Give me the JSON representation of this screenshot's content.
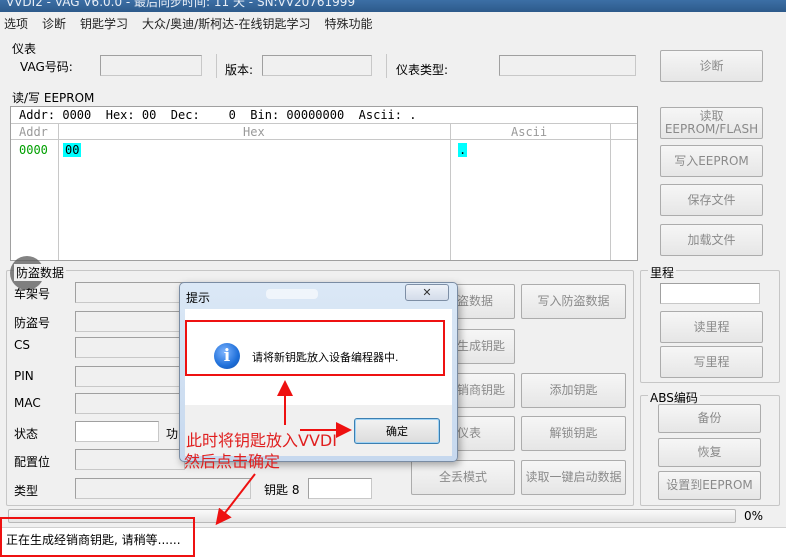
{
  "window": {
    "title": "VVDI2 - VAG V6.0.0 - 最后同步时间: 11 天 - SN:VV20761999"
  },
  "menu": [
    "选项",
    "诊断",
    "钥匙学习",
    "大众/奥迪/斯柯达-在线钥匙学习",
    "特殊功能"
  ],
  "instrument": {
    "group": "仪表",
    "vag_label": "VAG号码:",
    "version_label": "版本:",
    "type_label": "仪表类型:",
    "diagnose_button": "诊断"
  },
  "eeprom": {
    "group": "读/写 EEPROM",
    "info": {
      "addr_label": "Addr:",
      "addr": "0000",
      "hex_label": "Hex:",
      "hex": "00",
      "dec_label": "Dec:",
      "dec": "0",
      "bin_label": "Bin:",
      "bin": "00000000",
      "ascii_label": "Ascii:",
      "ascii": "."
    },
    "columns": {
      "addr": "Addr",
      "hex": "Hex",
      "ascii": "Ascii"
    },
    "row": {
      "addr": "0000",
      "hex": "00",
      "ascii": "."
    },
    "buttons": {
      "read": "读取\nEEPROM/FLASH",
      "write": "写入EEPROM",
      "save": "保存文件",
      "load": "加载文件"
    }
  },
  "immo": {
    "group": "防盗数据",
    "labels": {
      "vin": "车架号",
      "immo": "防盗号",
      "cs": "CS",
      "pin": "PIN",
      "mac": "MAC",
      "status": "状态",
      "config": "配置位",
      "type": "类型"
    },
    "status_suffix": "功",
    "key_label": "钥匙 8",
    "buttons": {
      "read_immo": "盗数据",
      "write_immo": "写入防盗数据",
      "gen_key": "生成钥匙",
      "dealer_key": "销商钥匙",
      "add_key": "添加钥匙",
      "instrument": "仪表",
      "unlock_key": "解锁钥匙",
      "all_lost": "全丢模式",
      "read_oneclick": "读取一键启动数据"
    }
  },
  "mileage": {
    "group": "里程",
    "read": "读里程",
    "write": "写里程"
  },
  "abs": {
    "group": "ABS编码",
    "backup": "备份",
    "restore": "恢复",
    "set_eeprom": "设置到EEPROM"
  },
  "progress": {
    "value": 0,
    "label": "0%"
  },
  "status_text": "正在生成经销商钥匙, 请稍等......",
  "dialog": {
    "title": "提示",
    "close": "✕",
    "message": "请将新钥匙放入设备编程器中.",
    "ok": "确定"
  },
  "annotation": {
    "line1": "此时将钥匙放入VVDI",
    "line2": "然后点击确定"
  },
  "colors": {
    "accent_red": "#e11111",
    "addr_green": "#00a000",
    "selection_cyan": "#00ffff",
    "info_blue": "#1e6fd9"
  }
}
